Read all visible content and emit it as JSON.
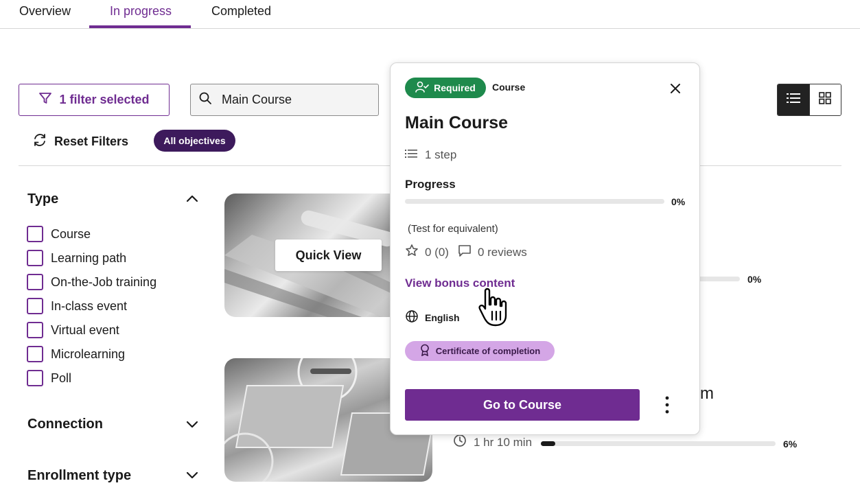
{
  "tabs": [
    {
      "label": "Overview",
      "active": false
    },
    {
      "label": "In progress",
      "active": true
    },
    {
      "label": "Completed",
      "active": false
    }
  ],
  "filters": {
    "filter_button_label": "1 filter selected",
    "search_value": "Main Course",
    "reset_label": "Reset Filters",
    "objectives_chip": "All objectives",
    "view_modes": [
      "list-icon",
      "grid-icon"
    ],
    "active_view": "list"
  },
  "sidebar": {
    "type_title": "Type",
    "type_options": [
      "Course",
      "Learning path",
      "On-the-Job training",
      "In-class event",
      "Virtual event",
      "Microlearning",
      "Poll"
    ],
    "connection_title": "Connection",
    "enrollment_title": "Enrollment type"
  },
  "cards": {
    "quick_view_label": "Quick View",
    "card1_progress_pct": "0%",
    "card1_progress_value": 0,
    "card2_partial_title": "m",
    "card2_duration": "1 hr 10 min",
    "card2_progress_pct": "6%",
    "card2_progress_value": 0.06
  },
  "popover": {
    "required_label": "Required",
    "type_label": "Course",
    "title": "Main Course",
    "steps": "1 step",
    "progress_label": "Progress",
    "progress_pct": "0%",
    "progress_value": 0,
    "description": "(Test for equivalent)",
    "rating": "0 (0)",
    "reviews": "0 reviews",
    "bonus_link": "View bonus content",
    "language": "English",
    "certificate": "Certificate of completion",
    "go_button": "Go to Course"
  },
  "colors": {
    "accent": "#6f2c91",
    "required_green": "#1e8a4c",
    "chip_dark": "#3d1a5c",
    "certificate_bg": "#d4a6e6"
  }
}
